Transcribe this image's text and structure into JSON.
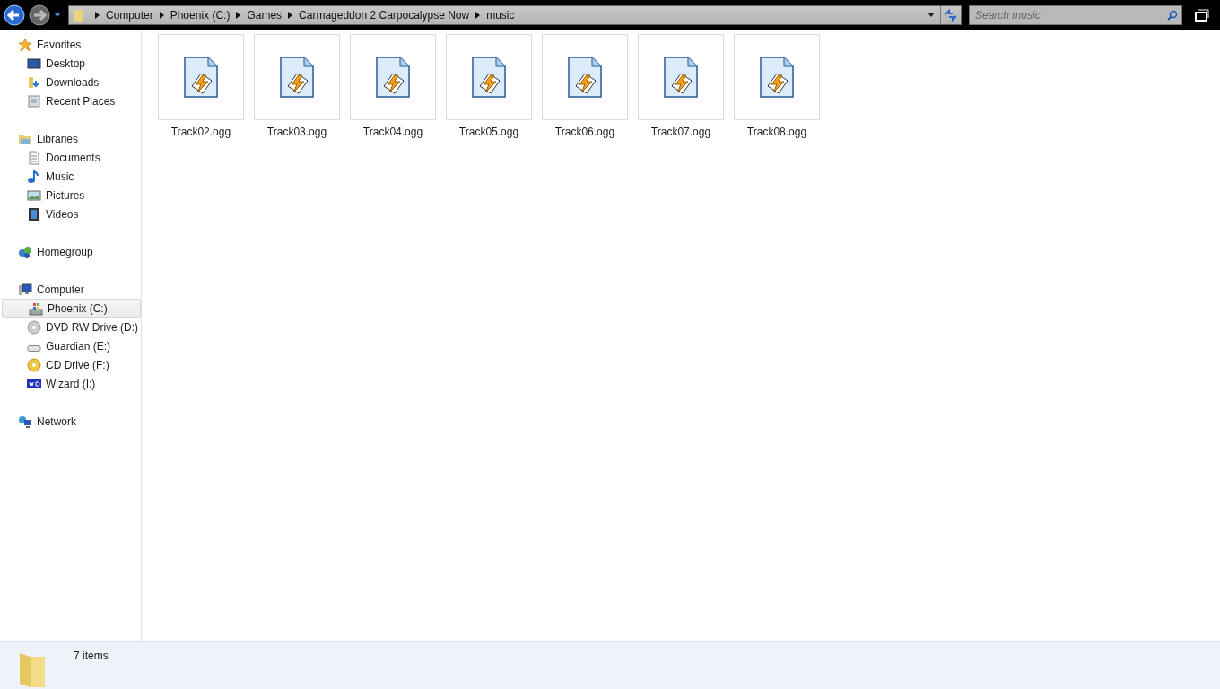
{
  "address_bar": {
    "crumbs": [
      "Computer",
      "Phoenix (C:)",
      "Games",
      "Carmageddon 2 Carpocalypse Now",
      "music"
    ]
  },
  "search": {
    "placeholder": "Search music"
  },
  "sidebar": {
    "groups": [
      {
        "label": "Favorites",
        "kind": "star",
        "children": [
          {
            "label": "Desktop",
            "kind": "desktop",
            "selected": false
          },
          {
            "label": "Downloads",
            "kind": "downloads",
            "selected": false
          },
          {
            "label": "Recent Places",
            "kind": "recent",
            "selected": false
          }
        ]
      },
      {
        "label": "Libraries",
        "kind": "library",
        "children": [
          {
            "label": "Documents",
            "kind": "document",
            "selected": false
          },
          {
            "label": "Music",
            "kind": "music",
            "selected": false
          },
          {
            "label": "Pictures",
            "kind": "picture",
            "selected": false
          },
          {
            "label": "Videos",
            "kind": "video",
            "selected": false
          }
        ]
      },
      {
        "label": "Homegroup",
        "kind": "homegroup"
      },
      {
        "label": "Computer",
        "kind": "computer",
        "children": [
          {
            "label": "Phoenix (C:)",
            "kind": "systemdrive",
            "selected": true
          },
          {
            "label": "DVD RW Drive (D:)",
            "kind": "dvd",
            "selected": false
          },
          {
            "label": "Guardian (E:)",
            "kind": "drive",
            "selected": false
          },
          {
            "label": "CD Drive (F:)",
            "kind": "cd",
            "selected": false
          },
          {
            "label": "Wizard (I:)",
            "kind": "wd",
            "selected": false
          }
        ]
      },
      {
        "label": "Network",
        "kind": "network"
      }
    ]
  },
  "files": [
    {
      "name": "Track02.ogg"
    },
    {
      "name": "Track03.ogg"
    },
    {
      "name": "Track04.ogg"
    },
    {
      "name": "Track05.ogg"
    },
    {
      "name": "Track06.ogg"
    },
    {
      "name": "Track07.ogg"
    },
    {
      "name": "Track08.ogg"
    }
  ],
  "status_bar": {
    "count": "7 items"
  }
}
